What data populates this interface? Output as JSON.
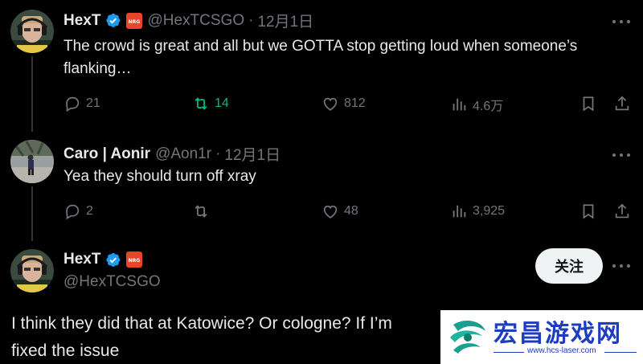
{
  "tweet1": {
    "name": "HexT",
    "handle": "@HexTCSGO",
    "date": "12月1日",
    "sep": "·",
    "text": "The crowd is great and all but we GOTTA stop getting loud when someone’s flanking…",
    "replies": "21",
    "retweets": "14",
    "likes": "812",
    "views": "4.6万"
  },
  "tweet2": {
    "name": "Caro | Aonir",
    "handle": "@Aon1r",
    "date": "12月1日",
    "sep": "·",
    "text": "Yea they should turn off xray",
    "replies": "2",
    "likes": "48",
    "views": "3,925"
  },
  "main": {
    "name": "HexT",
    "handle": "@HexTCSGO",
    "follow_label": "关注",
    "text_line1": "I think they did that at Katowice? Or cologne? If I’m",
    "text_line2": "fixed the issue"
  },
  "watermark": {
    "title": "宏昌游戏网",
    "url": "www.hcs-laser.com"
  },
  "colors": {
    "background": "#000000",
    "text": "#e7e9ea",
    "muted": "#71767b",
    "verified": "#1d9bf0",
    "retweet_active": "#00ba7c",
    "nrg_badge": "#e8452c"
  },
  "icons": [
    "reply-icon",
    "retweet-icon",
    "like-icon",
    "views-icon",
    "bookmark-icon",
    "share-icon",
    "more-icon",
    "verified-badge-icon",
    "nrg-badge-icon"
  ]
}
